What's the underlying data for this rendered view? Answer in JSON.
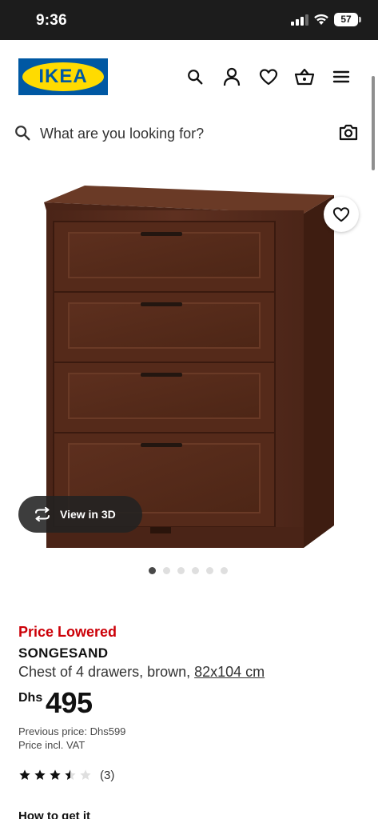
{
  "status_bar": {
    "time": "9:36",
    "battery": "57"
  },
  "header": {
    "logo_text": "IKEA",
    "brand_blue": "#0058a3",
    "brand_yellow": "#ffdb00",
    "icons": [
      "search-icon",
      "user-icon",
      "heart-icon",
      "basket-icon",
      "menu-icon"
    ]
  },
  "search": {
    "placeholder": "What are you looking for?"
  },
  "gallery": {
    "view3d_label": "View in 3D",
    "image_count": 6,
    "active_index": 0
  },
  "product": {
    "badge": "Price Lowered",
    "badge_color": "#cc0008",
    "name": "SONGESAND",
    "description": "Chest of 4 drawers, brown, ",
    "size": "82x104 cm",
    "currency": "Dhs",
    "price": "495",
    "previous_price": "Previous price: Dhs599",
    "vat_note": "Price incl. VAT",
    "rating": {
      "value": 3.5,
      "max": 5,
      "count_label": "(3)"
    }
  },
  "delivery": {
    "title": "How to get it"
  }
}
